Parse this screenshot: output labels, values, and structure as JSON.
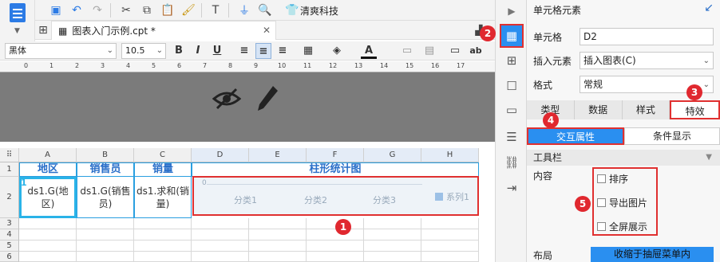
{
  "toolbar": {
    "user_name": "清爽科技"
  },
  "tab": {
    "file_name": "图表入门示例.cpt *"
  },
  "format": {
    "font_family": "黑体",
    "font_size": "10.5",
    "bold": "B",
    "italic": "I",
    "underline": "U",
    "font_color_label": "A",
    "ab": "ab"
  },
  "ruler": {
    "labels": [
      "0",
      "1",
      "2",
      "3",
      "4",
      "5",
      "6",
      "7",
      "8",
      "9",
      "10",
      "11",
      "12",
      "13",
      "14",
      "15",
      "16",
      "17"
    ]
  },
  "grid": {
    "columns": [
      "A",
      "B",
      "C",
      "D",
      "E",
      "F",
      "G",
      "H"
    ],
    "rows": [
      "1",
      "2",
      "3",
      "4",
      "5",
      "6"
    ],
    "corner": "⠿",
    "headers": {
      "a1": "地区",
      "b1": "销售员",
      "c1": "销量",
      "d1": "柱形统计图"
    },
    "data": {
      "a2": "ds1.G(地区)",
      "b2": "ds1.G(销售员)",
      "c2": "ds1.求和(销量)"
    },
    "row2_marker": "1"
  },
  "mini_chart": {
    "zero": "0",
    "categories": [
      "分类1",
      "分类2",
      "分类3"
    ],
    "legend": "系列1"
  },
  "badges": [
    "1",
    "2",
    "3",
    "4",
    "5"
  ],
  "panel": {
    "title": "单元格元素",
    "cell_label": "单元格",
    "cell_value": "D2",
    "insert_label": "插入元素",
    "insert_value": "插入图表(C)",
    "format_label": "格式",
    "format_value": "常规",
    "subtabs": [
      "类型",
      "数据",
      "样式",
      "特效"
    ],
    "inner_tabs": [
      "交互属性",
      "条件显示"
    ],
    "section": "工具栏",
    "content_label": "内容",
    "options": [
      "排序",
      "导出图片",
      "全屏展示"
    ],
    "layout_label": "布局",
    "layout_value": "收缩于抽屉菜单内"
  },
  "colors": {
    "accent": "#2a8ff0",
    "badge": "#e0282f",
    "header_text": "#2a6fc9"
  }
}
